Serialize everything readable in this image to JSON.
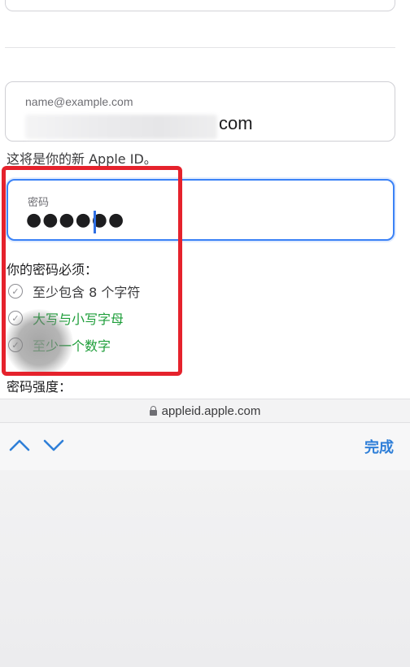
{
  "form": {
    "email": {
      "placeholder": "name@example.com",
      "visible_suffix": "com",
      "hint": "这将是你的新 Apple ID。"
    },
    "password": {
      "label": "密码",
      "masked_value": "●●●●●●"
    },
    "requirements": {
      "title": "你的密码必须：",
      "items": [
        {
          "text": "至少包含 8 个字符",
          "met": false
        },
        {
          "text": "大写与小写字母",
          "met": true
        },
        {
          "text": "至少一个数字",
          "met": true
        }
      ]
    },
    "strength_label": "密码强度："
  },
  "browser": {
    "url": "appleid.apple.com"
  },
  "keyboard_accessory": {
    "done_label": "完成",
    "prev_icon": "chevron-up-icon",
    "next_icon": "chevron-down-icon"
  },
  "colors": {
    "accent_blue": "#2f7fd8",
    "focus_border": "#3b82f6",
    "requirement_met": "#1e9e3a",
    "highlight_red": "#e5222c"
  }
}
